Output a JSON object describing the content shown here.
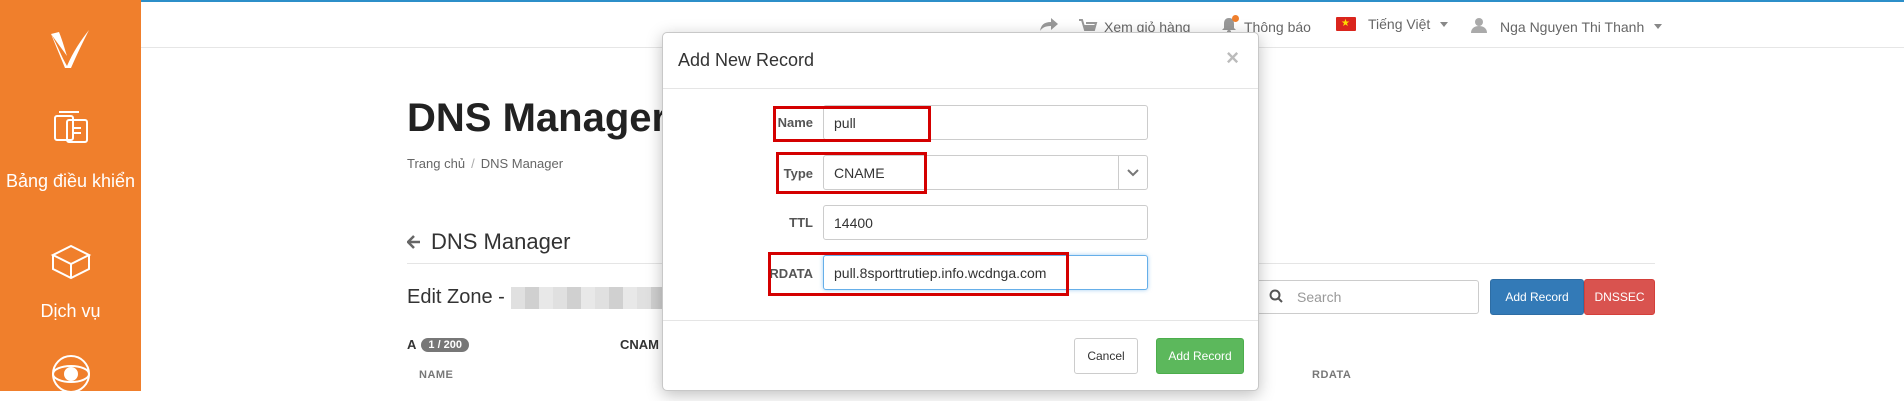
{
  "sidebar": {
    "items": [
      {
        "label": "Bảng điều khiển",
        "icon": "dashboard-icon"
      },
      {
        "label": "Dịch vụ",
        "icon": "services-box-icon"
      },
      {
        "label": "",
        "icon": "globe-icon"
      }
    ]
  },
  "topbar": {
    "cart_label": "Xem giỏ hàng",
    "notifications_label": "Thông báo",
    "language_label": "Tiếng Việt",
    "user_name": "Nga Nguyen Thi Thanh"
  },
  "page": {
    "title": "DNS Manager",
    "breadcrumb_home": "Trang chủ",
    "breadcrumb_current": "DNS Manager",
    "section_title": "DNS Manager",
    "edit_zone_label": "Edit Zone -",
    "search_placeholder": "Search",
    "add_record_button": "Add Record",
    "dnssec_button": "DNSSEC",
    "a_label": "A",
    "a_count": "1 / 200",
    "cname_label": "CNAM",
    "col_name": "NAME",
    "col_rdata": "RDATA"
  },
  "modal": {
    "title": "Add New Record",
    "close": "×",
    "fields": {
      "name_label": "Name",
      "name_value": "pull",
      "type_label": "Type",
      "type_value": "CNAME",
      "ttl_label": "TTL",
      "ttl_value": "14400",
      "rdata_label": "RDATA",
      "rdata_value": "pull.8sporttrutiep.info.wcdnga.com"
    },
    "cancel_button": "Cancel",
    "add_button": "Add Record"
  },
  "colors": {
    "sidebar": "#f07f2c",
    "primary": "#337ab7",
    "danger": "#d9534f",
    "success": "#5cb85c",
    "highlight": "#d40000"
  }
}
